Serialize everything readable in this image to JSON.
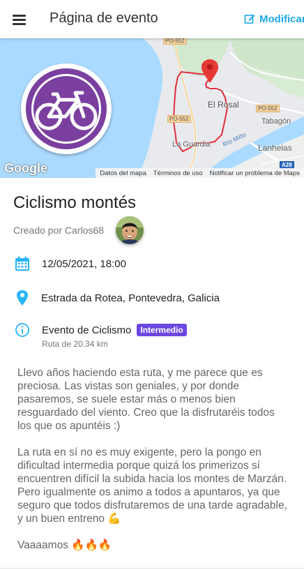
{
  "appbar": {
    "title": "Página de evento",
    "edit_label": "Modificar",
    "menu_icon": "menu-icon",
    "edit_icon": "edit-icon",
    "accent_color": "#1ea7e8"
  },
  "map": {
    "places": {
      "el_rosal": "El Rosal",
      "tabagon": "Tabagón",
      "la_guardia": "La Guardia",
      "lanhelas": "Lanhelas",
      "rio_mino": "Río Miño"
    },
    "roads": {
      "po552_top": "PO-552",
      "po552_left": "PO-552",
      "po552_right": "PO-552",
      "a28": "A28"
    },
    "google_logo": "Google",
    "footer": {
      "data": "Datos del mapa",
      "terms": "Términos de uso",
      "report": "Notificar un problema de Maps"
    },
    "route_color": "#e0303a",
    "pin_color": "#e53935"
  },
  "event": {
    "sport_icon": "bicycle-icon",
    "sport_color": "#7b3fa0",
    "title": "Ciclismo montés",
    "creator": "Creado por Carlos68",
    "datetime": "12/05/2021, 18:00",
    "location": "Estrada da Rotea, Pontevedra, Galicia",
    "type": "Evento de Ciclismo",
    "level": "Intermedio",
    "level_color": "#6c47e0",
    "route": "Ruta de 20.34 km",
    "icon_color": "#29b6f6"
  },
  "description": {
    "p1": "Llevo años haciendo esta ruta, y me parece que es preciosa. Las vistas son geniales, y por donde pasaremos, se suele estar más o menos bien resguardado del viento. Creo que la disfrutaréis todos los que os apuntéis :)",
    "p2": "La ruta en sí no es muy exigente, pero la pongo en dificultad intermedia porque quizá los primerizos sí encuentren difícil la subida hacia los montes de Marzán. Pero igualmente os animo a todos a apuntaros, ya que seguro que todos disfrutaremos de una tarde agradable, y un buen entreno 💪",
    "p3": "Vaaaamos 🔥🔥🔥"
  }
}
